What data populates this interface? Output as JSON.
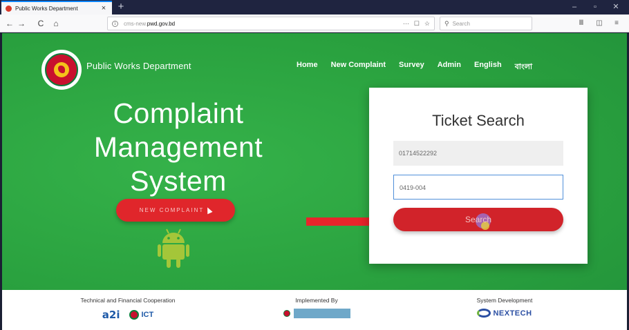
{
  "browser": {
    "tab_title": "Public Works Department",
    "tab_close": "×",
    "new_tab": "+",
    "window_controls": [
      "–",
      "▫",
      "✕"
    ],
    "url_prefix": "cms-new.",
    "url_domain": "pwd.gov.bd",
    "url_actions": [
      "···",
      "☐",
      "☆"
    ],
    "search_placeholder": "Search",
    "nav_icons": [
      "back-icon",
      "forward-icon",
      "reload-icon",
      "home-icon"
    ],
    "nav_glyphs": [
      "←",
      "→",
      "C",
      "⌂"
    ],
    "toolbar_glyphs": [
      "Ⅲ",
      "◫",
      "≡"
    ]
  },
  "site": {
    "brand": "Public Works Department",
    "nav": [
      "Home",
      "New Complaint",
      "Survey",
      "Admin",
      "English",
      "বাংলা"
    ],
    "hero_title": [
      "Complaint",
      "Management",
      "System"
    ],
    "new_complaint_label": "NEW COMPLAINT",
    "accent_green": "#2aa23f",
    "accent_red": "#d1232a"
  },
  "ticket": {
    "title": "Ticket Search",
    "phone_value": "01714522292",
    "ticket_value": "0419-004",
    "search_label": "Search"
  },
  "footer": {
    "cooperation_heading": "Technical and Financial Cooperation",
    "implemented_heading": "Implemented By",
    "development_heading": "System Development",
    "a2i_text": "a2i",
    "ict_text": "ICT",
    "nextech_text": "NEXTECH"
  }
}
